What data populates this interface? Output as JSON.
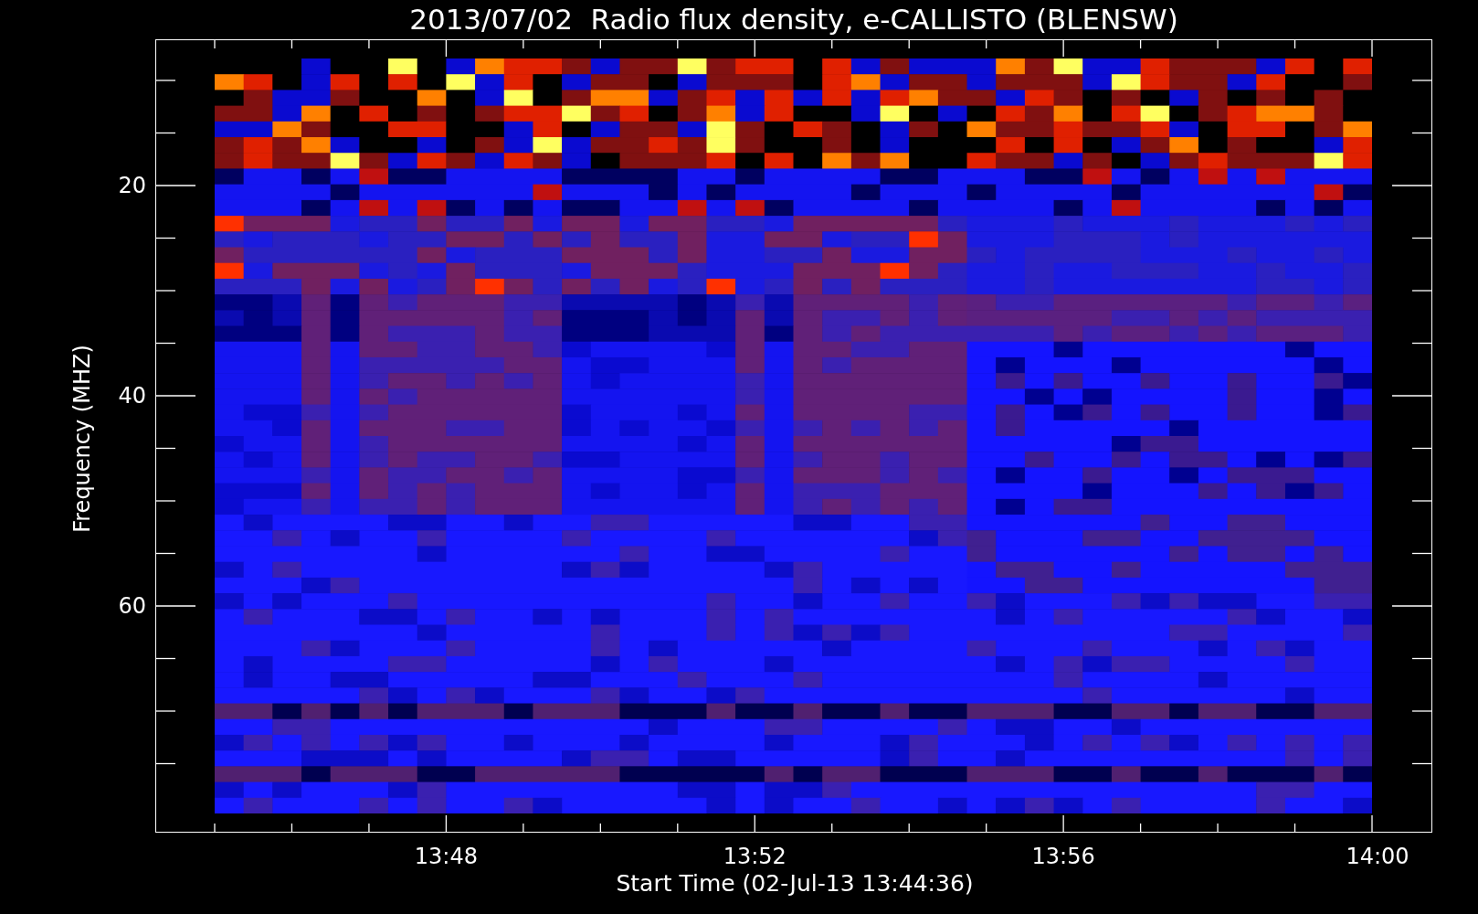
{
  "title": "2013/07/02  Radio flux density, e-CALLISTO (BLENSW)",
  "y_axis": {
    "label": "Frequency (MHZ)",
    "ticks": [
      "20",
      "40",
      "60"
    ]
  },
  "x_axis": {
    "label": "Start Time (02-Jul-13 13:44:36)",
    "ticks": [
      "13:48",
      "13:52",
      "13:56",
      "14:00"
    ]
  }
}
